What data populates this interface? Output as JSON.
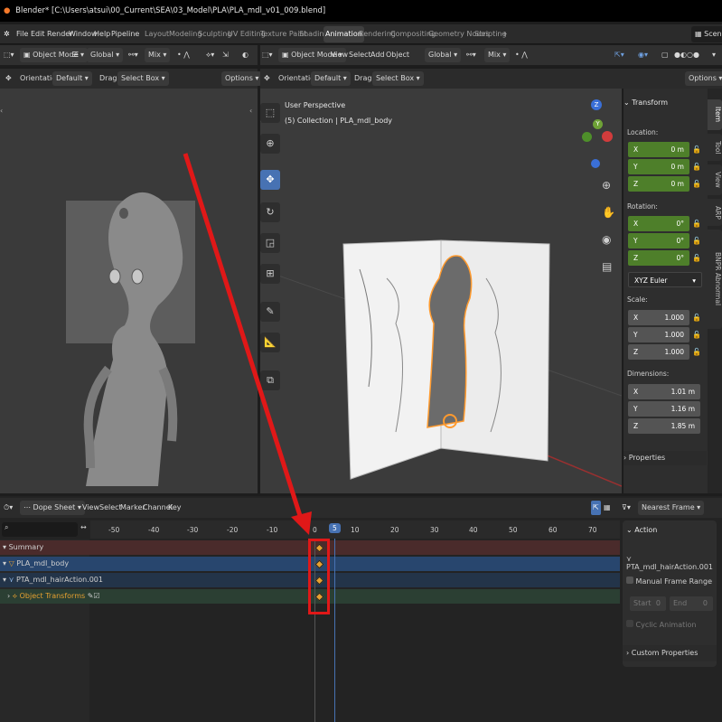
{
  "title_bar": "Blender* [C:\\Users\\atsui\\00_Current\\SEA\\03_Model\\PLA\\PLA_mdl_v01_009.blend]",
  "menu": [
    "File",
    "Edit",
    "Render",
    "Window",
    "Help",
    "Pipeline"
  ],
  "workspaces": [
    "Layout",
    "Modeling",
    "Sculpting",
    "UV Editing",
    "Texture Paint",
    "Shading",
    "Animation",
    "Rendering",
    "Compositing",
    "Geometry Nodes",
    "Scripting"
  ],
  "active_workspace": "Animation",
  "scene_label": "Scene",
  "left_view": {
    "mode": "Object Mode",
    "transform": "Global",
    "shading": "Mix",
    "orientation_label": "Orientation:",
    "orientation_value": "Default",
    "drag_label": "Drag:",
    "drag_value": "Select Box",
    "options": "Options"
  },
  "right_view": {
    "mode": "Object Mode",
    "menus": [
      "View",
      "Select",
      "Add",
      "Object"
    ],
    "transform": "Global",
    "shading": "Mix",
    "orientation_label": "Orientation:",
    "orientation_value": "Default",
    "drag_label": "Drag:",
    "drag_value": "Select Box",
    "options": "Options",
    "overlay_line1": "User Perspective",
    "overlay_line2": "(5) Collection | PLA_mdl_body"
  },
  "gizmo": {
    "z": "Z",
    "y": "Y"
  },
  "n_panel": {
    "header": "Transform",
    "location_label": "Location:",
    "location": [
      {
        "axis": "X",
        "value": "0 m"
      },
      {
        "axis": "Y",
        "value": "0 m"
      },
      {
        "axis": "Z",
        "value": "0 m"
      }
    ],
    "rotation_label": "Rotation:",
    "rotation": [
      {
        "axis": "X",
        "value": "0°"
      },
      {
        "axis": "Y",
        "value": "0°"
      },
      {
        "axis": "Z",
        "value": "0°"
      }
    ],
    "rotation_mode": "XYZ Euler",
    "scale_label": "Scale:",
    "scale": [
      {
        "axis": "X",
        "value": "1.000"
      },
      {
        "axis": "Y",
        "value": "1.000"
      },
      {
        "axis": "Z",
        "value": "1.000"
      }
    ],
    "dimensions_label": "Dimensions:",
    "dimensions": [
      {
        "axis": "X",
        "value": "1.01 m"
      },
      {
        "axis": "Y",
        "value": "1.16 m"
      },
      {
        "axis": "Z",
        "value": "1.85 m"
      }
    ],
    "properties": "Properties",
    "tabs": [
      "Item",
      "Tool",
      "View",
      "ARP",
      "BNPR Abnormal"
    ]
  },
  "dope_sheet": {
    "editor": "Dope Sheet",
    "menus": [
      "View",
      "Select",
      "Marker",
      "Channel",
      "Key"
    ],
    "snap": "Nearest Frame",
    "ruler": [
      "-50",
      "-40",
      "-30",
      "-20",
      "-10",
      "0",
      "5",
      "10",
      "20",
      "30",
      "40",
      "50",
      "60",
      "70"
    ],
    "current_frame": "5",
    "channels": [
      {
        "label": "Summary"
      },
      {
        "label": "PLA_mdl_body"
      },
      {
        "label": "PTA_mdl_hairAction.001"
      },
      {
        "label": "Object Transforms"
      }
    ],
    "action_panel": {
      "header": "Action",
      "action_name": "PTA_mdl_hairAction.001",
      "manual_frame_range": "Manual Frame Range",
      "start_label": "Start",
      "start_value": "0",
      "end_label": "End",
      "end_value": "0",
      "cyclic": "Cyclic Animation",
      "custom_properties": "Custom Properties"
    }
  },
  "accent_colors": {
    "highlight": "#4772b3",
    "keyframe": "#e5a030",
    "annotation": "#e01818",
    "location_field": "#4e7f2a"
  }
}
